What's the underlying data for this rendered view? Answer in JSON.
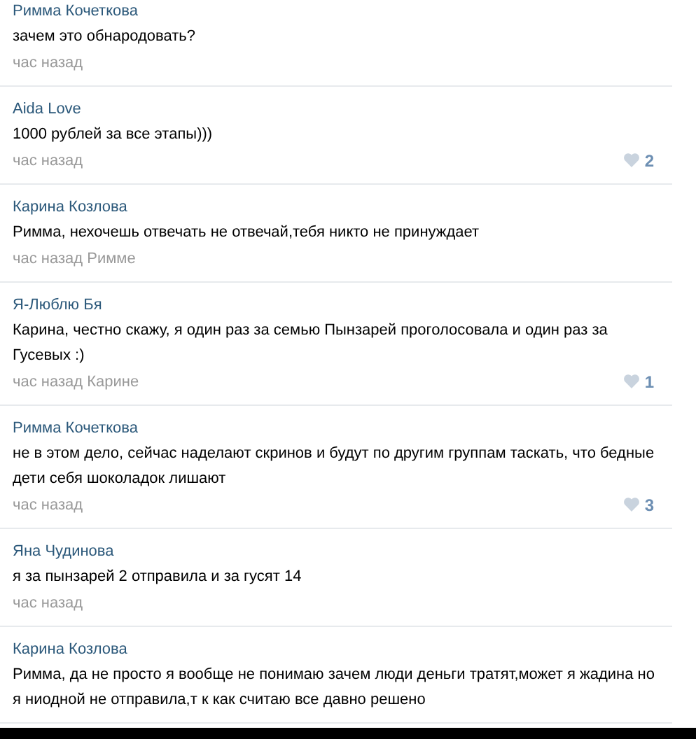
{
  "comments": [
    {
      "author": "Римма Кочеткова",
      "text": "зачем это обнародовать?",
      "time": "час назад"
    },
    {
      "author": "Aida Love",
      "text": "1000 рублей за все этапы)))",
      "time": "час назад",
      "likes": "2"
    },
    {
      "author": "Карина Козлова",
      "text": "Римма, нехочешь отвечать не отвечай,тебя никто не принуждает",
      "time": "час назад Римме"
    },
    {
      "author": "Я-Люблю Бя",
      "text": "Карина, честно скажу, я один раз за семью Пынзарей проголосовала и один раз за Гусевых :)",
      "time": "час назад Карине",
      "likes": "1"
    },
    {
      "author": "Римма Кочеткова",
      "text": "не в этом дело, сейчас наделают скринов и будут по другим группам таскать, что бедные дети себя шоколадок лишают",
      "time": "час назад",
      "likes": "3"
    },
    {
      "author": "Яна Чудинова",
      "text": "я за пынзарей 2 отправила и за гусят  14",
      "time": "час назад"
    },
    {
      "author": "Карина Козлова",
      "text": "Римма, да не просто я вообще не понимаю зачем люди деньги тратят,может я жадина но я ниодной не отправила,т к как считаю все давно решено"
    }
  ]
}
